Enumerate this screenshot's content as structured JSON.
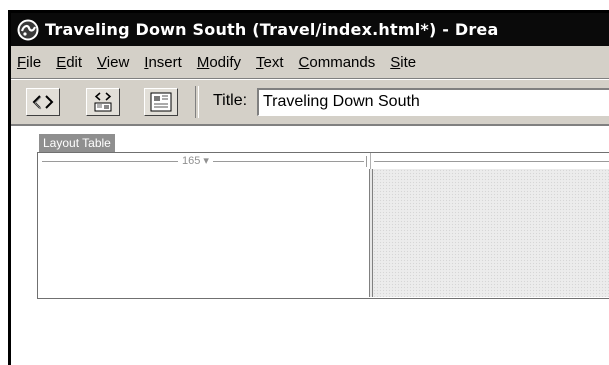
{
  "window": {
    "title": "Traveling Down South (Travel/index.html*) - Drea"
  },
  "menubar": {
    "items": [
      {
        "acc": "F",
        "rest": "ile"
      },
      {
        "acc": "E",
        "rest": "dit"
      },
      {
        "acc": "V",
        "rest": "iew"
      },
      {
        "acc": "I",
        "rest": "nsert"
      },
      {
        "acc": "M",
        "rest": "odify"
      },
      {
        "acc": "T",
        "rest": "ext"
      },
      {
        "acc": "C",
        "rest": "ommands"
      },
      {
        "acc": "S",
        "rest": "ite"
      }
    ]
  },
  "toolbar": {
    "buttons": [
      "code-view-icon",
      "split-view-icon",
      "design-view-icon"
    ],
    "title_label": "Title:",
    "title_value": "Traveling Down South"
  },
  "document": {
    "layout_table_label": "Layout Table",
    "column_width_label": "165 ▾"
  }
}
